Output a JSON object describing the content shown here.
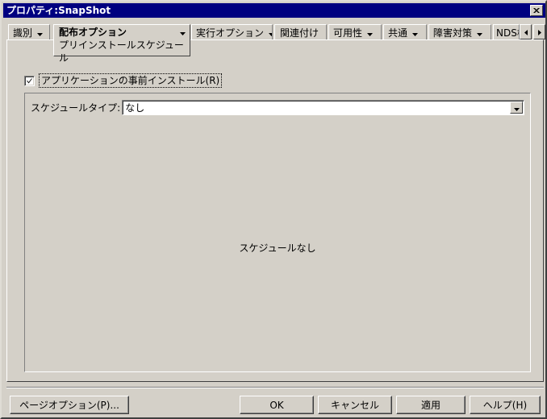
{
  "window": {
    "title": "プロパティ:SnapShot",
    "close_icon": "close-icon",
    "colors": {
      "titlebar": "#000080",
      "face": "#d4d0c8",
      "shadow": "#808080",
      "highlight": "#ffffff",
      "dark": "#3f3f3f",
      "field": "#ffffff",
      "text": "#000000"
    }
  },
  "tabs": {
    "items": [
      {
        "label": "識別",
        "has_arrow": true,
        "active": false
      },
      {
        "label": "実行オプション",
        "has_arrow": true,
        "active": false
      },
      {
        "label": "関連付け",
        "has_arrow": false,
        "active": false
      },
      {
        "label": "可用性",
        "has_arrow": true,
        "active": false
      },
      {
        "label": "共通",
        "has_arrow": true,
        "active": false
      },
      {
        "label": "障害対策",
        "has_arrow": true,
        "active": false
      },
      {
        "label": "NDS権",
        "has_arrow": false,
        "active": false
      }
    ],
    "active_tab": {
      "label": "配布オプション",
      "sublabel": "プリインストールスケジュール",
      "has_arrow": true
    },
    "scroll_left_icon": "arrow-left-icon",
    "scroll_right_icon": "arrow-right-icon"
  },
  "page": {
    "preinstall_checkbox": {
      "label": "アプリケーションの事前インストール(R)",
      "checked": true,
      "focused": true
    },
    "schedule_type": {
      "label": "スケジュールタイプ:",
      "value": "なし",
      "dropdown_icon": "chevron-down-icon"
    },
    "empty_message": "スケジュールなし"
  },
  "buttons": {
    "page_options": "ページオプション(P)...",
    "ok": "OK",
    "cancel": "キャンセル",
    "apply": "適用",
    "help": "ヘルプ(H)"
  }
}
